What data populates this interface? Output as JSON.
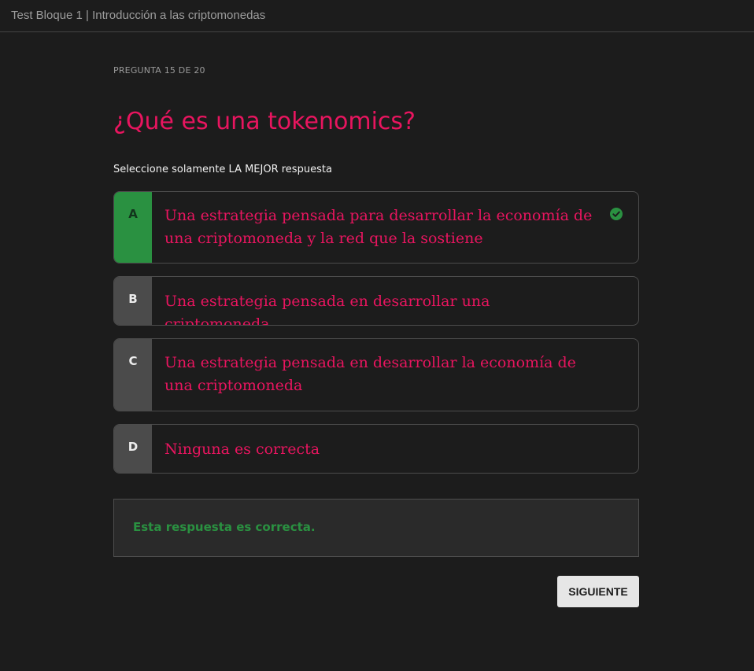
{
  "window": {
    "title": "Test Bloque 1 | Introducción a las criptomonedas"
  },
  "quiz": {
    "progress": "PREGUNTA 15 DE 20",
    "question": "¿Qué es una tokenomics?",
    "instruction": "Seleccione solamente LA MEJOR respuesta",
    "options": [
      {
        "letter": "A",
        "text": "Una estrategia pensada para desarrollar la economía de una criptomoneda y la red que la sostiene",
        "selected": true,
        "correct": true,
        "icon": "check-circle-icon"
      },
      {
        "letter": "B",
        "text": "Una estrategia pensada en desarrollar una criptomoneda",
        "selected": false
      },
      {
        "letter": "C",
        "text": "Una estrategia pensada en desarrollar la economía de una criptomoneda",
        "selected": false
      },
      {
        "letter": "D",
        "text": "Ninguna es correcta",
        "selected": false
      }
    ],
    "feedback": "Esta respuesta es correcta.",
    "next_label": "SIGUIENTE"
  },
  "colors": {
    "background": "#1c1c1c",
    "accent_pink": "#e8155f",
    "correct_green": "#2a9141",
    "letter_bg": "#4b4b4b",
    "button_bg": "#e6e6e6"
  }
}
